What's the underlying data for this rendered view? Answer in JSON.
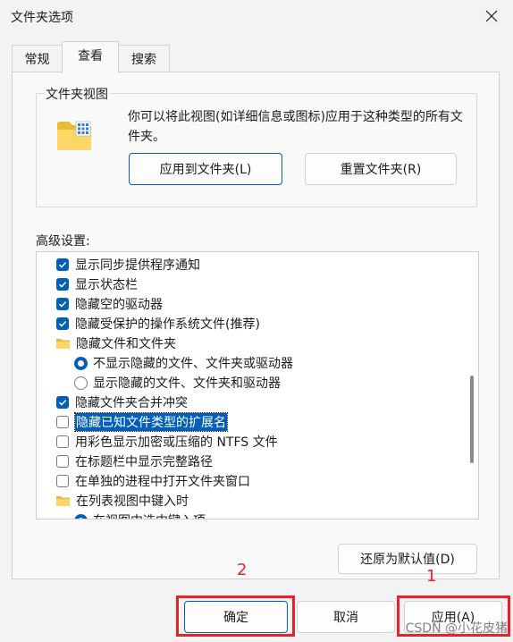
{
  "window": {
    "title": "文件夹选项"
  },
  "tabs": [
    {
      "label": "常规"
    },
    {
      "label": "查看"
    },
    {
      "label": "搜索"
    }
  ],
  "folder_views": {
    "group_title": "文件夹视图",
    "description": "你可以将此视图(如详细信息或图标)应用于这种类型的所有文件夹。",
    "apply_button": "应用到文件夹(L)",
    "reset_button": "重置文件夹(R)"
  },
  "advanced": {
    "label": "高级设置:",
    "items": [
      {
        "kind": "checkbox",
        "checked": true,
        "label": "显示同步提供程序通知"
      },
      {
        "kind": "checkbox",
        "checked": true,
        "label": "显示状态栏"
      },
      {
        "kind": "checkbox",
        "checked": true,
        "label": "隐藏空的驱动器"
      },
      {
        "kind": "checkbox",
        "checked": true,
        "label": "隐藏受保护的操作系统文件(推荐)"
      },
      {
        "kind": "folder",
        "label": "隐藏文件和文件夹"
      },
      {
        "kind": "radio",
        "checked": true,
        "label": "不显示隐藏的文件、文件夹或驱动器"
      },
      {
        "kind": "radio",
        "checked": false,
        "label": "显示隐藏的文件、文件夹和驱动器"
      },
      {
        "kind": "checkbox",
        "checked": true,
        "label": "隐藏文件夹合并冲突"
      },
      {
        "kind": "checkbox",
        "checked": false,
        "label": "隐藏已知文件类型的扩展名",
        "selected": true
      },
      {
        "kind": "checkbox",
        "checked": false,
        "label": "用彩色显示加密或压缩的 NTFS 文件"
      },
      {
        "kind": "checkbox",
        "checked": false,
        "label": "在标题栏中显示完整路径"
      },
      {
        "kind": "checkbox",
        "checked": false,
        "label": "在单独的进程中打开文件夹窗口"
      },
      {
        "kind": "folder",
        "label": "在列表视图中键入时"
      },
      {
        "kind": "radio",
        "checked": true,
        "label": "在视图中选中键入项"
      }
    ]
  },
  "restore_defaults_button": "还原为默认值(D)",
  "footer": {
    "ok_button": "确定",
    "cancel_button": "取消",
    "apply_button": "应用(A)"
  },
  "annotations": {
    "mark_1": "1",
    "mark_2": "2",
    "color": "#e8222a"
  },
  "watermark": "CSDN @小花皮猪",
  "colors": {
    "accent": "#005fb8",
    "window_bg": "#f3f3f3",
    "panel_bg": "#f9f9f9"
  }
}
